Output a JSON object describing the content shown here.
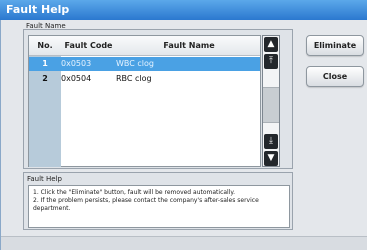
{
  "window": {
    "title": "Fault Help"
  },
  "fault_list": {
    "group_label": "Fault Name",
    "columns": [
      "No.",
      "Fault Code",
      "Fault Name"
    ],
    "rows": [
      {
        "no": "1",
        "code": "0x0503",
        "name": "WBC clog",
        "selected": true
      },
      {
        "no": "2",
        "code": "0x0504",
        "name": "RBC clog",
        "selected": false
      }
    ]
  },
  "help": {
    "group_label": "Fault Help",
    "line1": "1. Click the \"Eliminate\" button, fault will be removed automatically.",
    "line2": "2. If the problem persists, please contact the company's after-sales service department."
  },
  "buttons": {
    "eliminate": "Eliminate",
    "close": "Close"
  },
  "scrollbar": {
    "top": "▲",
    "page_up": "⤒",
    "page_down": "⤓",
    "bottom": "▼"
  },
  "colors": {
    "titlebar": "#2b78cf",
    "selected_row": "#4aa1e4"
  }
}
